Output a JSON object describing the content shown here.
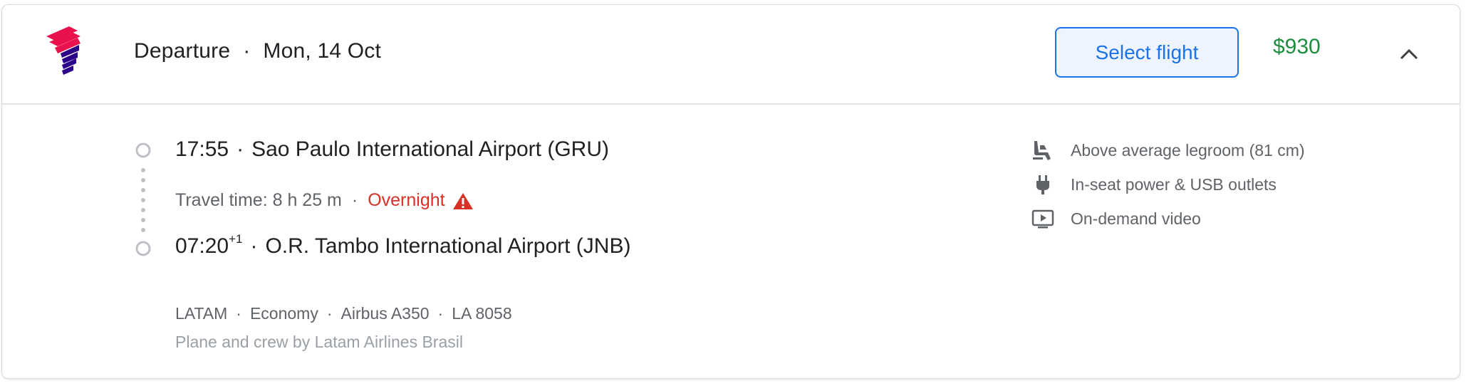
{
  "header": {
    "airline_logo": "latam-logo",
    "title": "Departure",
    "separator": "·",
    "date": "Mon, 14 Oct",
    "select_button_label": "Select flight",
    "price": "$930",
    "collapse_icon": "chevron-up-icon"
  },
  "itinerary": {
    "departure": {
      "time": "17:55",
      "separator": "·",
      "airport": "Sao Paulo International Airport (GRU)"
    },
    "travel": {
      "text": "Travel time: 8 h 25 m",
      "separator": "·",
      "overnight": "Overnight",
      "warning_icon": "warning-triangle-icon"
    },
    "arrival": {
      "time": "07:20",
      "day_offset": "+1",
      "separator": "·",
      "airport": "O.R. Tambo International Airport (JNB)"
    },
    "details": [
      "LATAM",
      "Economy",
      "Airbus A350",
      "LA 8058"
    ],
    "details_separator": "·",
    "operated_by": "Plane and crew by Latam Airlines Brasil"
  },
  "amenities": [
    {
      "icon": "seat-legroom-icon",
      "label": "Above average legroom (81 cm)"
    },
    {
      "icon": "power-plug-icon",
      "label": "In-seat power & USB outlets"
    },
    {
      "icon": "video-play-icon",
      "label": "On-demand video"
    }
  ],
  "colors": {
    "accent": "#1a73e8",
    "price": "#1e8e3e",
    "warning": "#d93025",
    "logo_red": "#e8114b",
    "logo_indigo": "#2b0088"
  }
}
